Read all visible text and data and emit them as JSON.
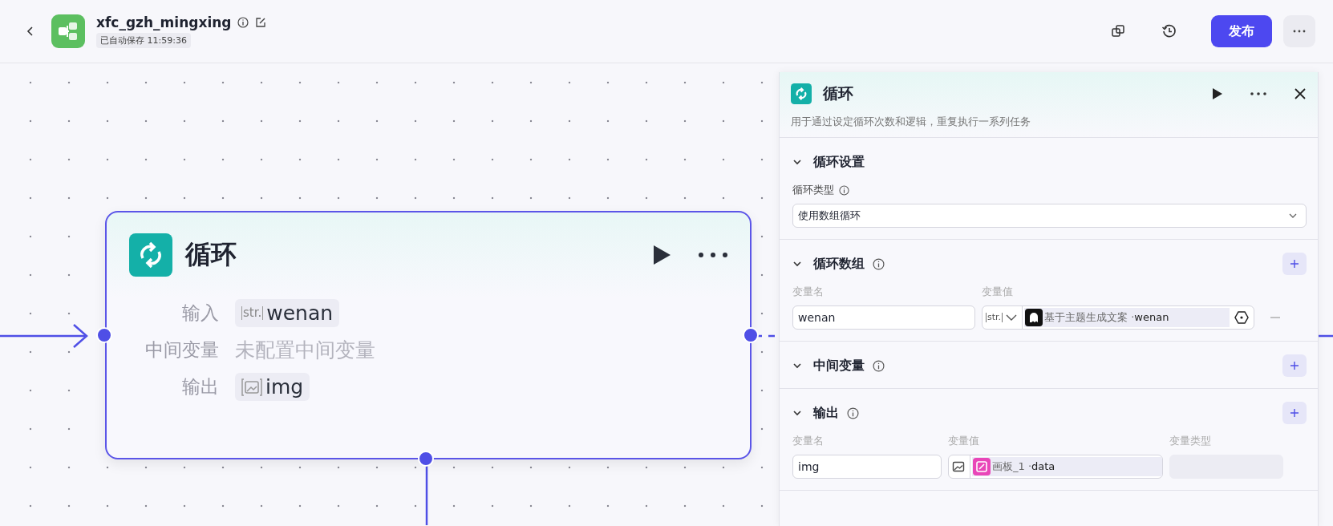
{
  "header": {
    "title": "xfc_gzh_mingxing",
    "save_status": "已自动保存 11:59:36",
    "publish_label": "发布"
  },
  "node": {
    "title": "循环",
    "rows": [
      {
        "label": "输入",
        "kind": "string",
        "type_label": "str.",
        "value": "wenan"
      },
      {
        "label": "中间变量",
        "kind": "empty",
        "value": "未配置中间变量"
      },
      {
        "label": "输出",
        "kind": "image",
        "value": "img"
      }
    ]
  },
  "panel": {
    "title": "循环",
    "description": "用于通过设定循环次数和逻辑，重复执行一系列任务",
    "sections": [
      {
        "kind": "settings",
        "title": "循环设置",
        "expanded": true,
        "field_label": "循环类型",
        "select_value": "使用数组循环"
      },
      {
        "kind": "variables",
        "title": "循环数组",
        "expanded": true,
        "columns": [
          "变量名",
          "变量值"
        ],
        "rows": [
          {
            "name": "wenan",
            "kind": "string",
            "type_label": "str.",
            "source": "基于主题生成文案 ·",
            "variable": "wenan"
          }
        ]
      },
      {
        "kind": "variables",
        "title": "中间变量",
        "expanded": true
      },
      {
        "kind": "variables",
        "title": "输出",
        "expanded": true,
        "columns": [
          "变量名",
          "变量值",
          "变量类型"
        ],
        "rows": [
          {
            "name": "img",
            "kind": "image",
            "source": "画板_1 ·",
            "variable": "data"
          }
        ]
      }
    ]
  }
}
